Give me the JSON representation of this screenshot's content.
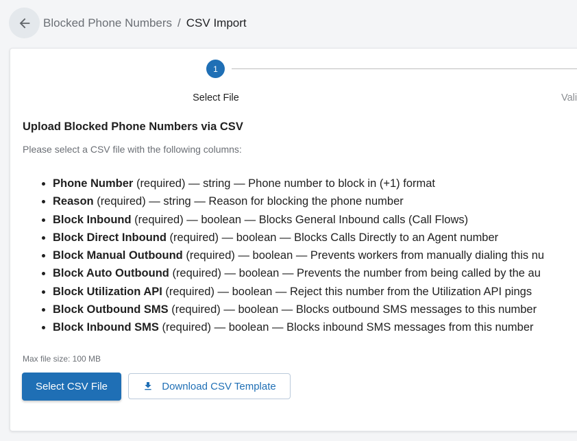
{
  "header": {
    "back_icon": "arrow-left-icon",
    "breadcrumb_parent": "Blocked Phone Numbers",
    "breadcrumb_separator": "/",
    "breadcrumb_current": "CSV Import"
  },
  "stepper": {
    "active_step_number": "1",
    "steps": [
      {
        "label": "Select File"
      },
      {
        "label": "Vali"
      }
    ]
  },
  "upload": {
    "title": "Upload Blocked Phone Numbers via CSV",
    "subtitle": "Please select a CSV file with the following columns:",
    "columns": [
      {
        "name": "Phone Number",
        "desc": " (required) — string — Phone number to block in (+1) format"
      },
      {
        "name": "Reason",
        "desc": " (required) — string — Reason for blocking the phone number"
      },
      {
        "name": "Block Inbound",
        "desc": " (required) — boolean — Blocks General Inbound calls (Call Flows)"
      },
      {
        "name": "Block Direct Inbound",
        "desc": " (required) — boolean — Blocks Calls Directly to an Agent number"
      },
      {
        "name": "Block Manual Outbound",
        "desc": " (required) — boolean — Prevents workers from manually dialing this nu"
      },
      {
        "name": "Block Auto Outbound",
        "desc": " (required) — boolean — Prevents the number from being called by the au"
      },
      {
        "name": "Block Utilization API",
        "desc": " (required) — boolean — Reject this number from the Utilization API pings"
      },
      {
        "name": "Block Outbound SMS",
        "desc": " (required) — boolean — Blocks outbound SMS messages to this number"
      },
      {
        "name": "Block Inbound SMS",
        "desc": " (required) — boolean — Blocks inbound SMS messages from this number"
      }
    ],
    "max_file_size": "Max file size: 100 MB",
    "select_button": "Select CSV File",
    "download_button": "Download CSV Template",
    "download_icon": "download-icon"
  },
  "colors": {
    "primary": "#1f6fb5",
    "background": "#f4f5f7"
  }
}
